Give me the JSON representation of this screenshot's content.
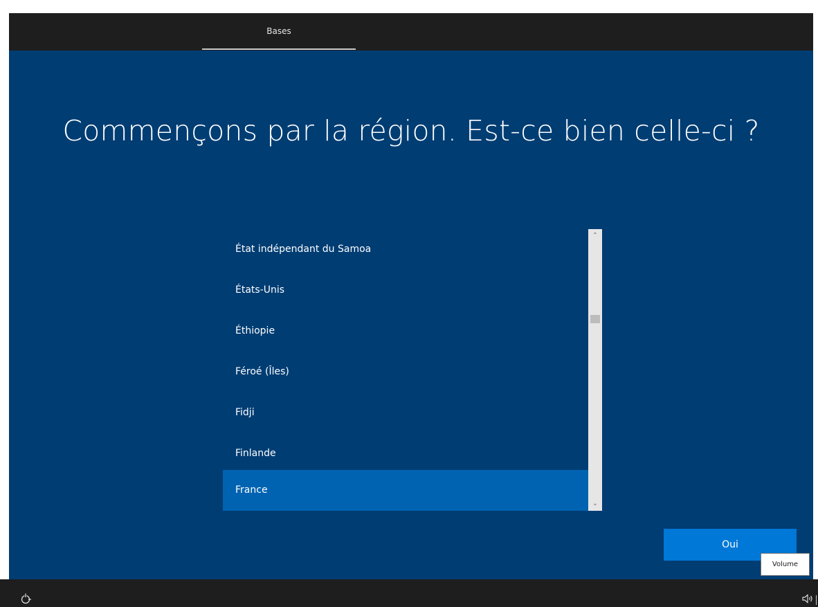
{
  "header": {
    "tab_label": "Bases"
  },
  "main": {
    "title": "Commençons par la région. Est-ce bien celle-ci ?",
    "regions": [
      {
        "label": "État indépendant du Samoa",
        "selected": false
      },
      {
        "label": "États-Unis",
        "selected": false
      },
      {
        "label": "Éthiopie",
        "selected": false
      },
      {
        "label": "Féroé (Îles)",
        "selected": false
      },
      {
        "label": "Fidji",
        "selected": false
      },
      {
        "label": "Finlande",
        "selected": false
      },
      {
        "label": "France",
        "selected": true
      }
    ],
    "confirm_button": "Oui"
  },
  "taskbar": {
    "accessibility_icon": "accessibility-icon",
    "volume_icon": "volume-icon"
  },
  "tooltip": {
    "text": "Volume"
  },
  "colors": {
    "background": "#003d73",
    "selected_item": "#0063b1",
    "button": "#0078d7",
    "bars": "#1e1e1e"
  }
}
